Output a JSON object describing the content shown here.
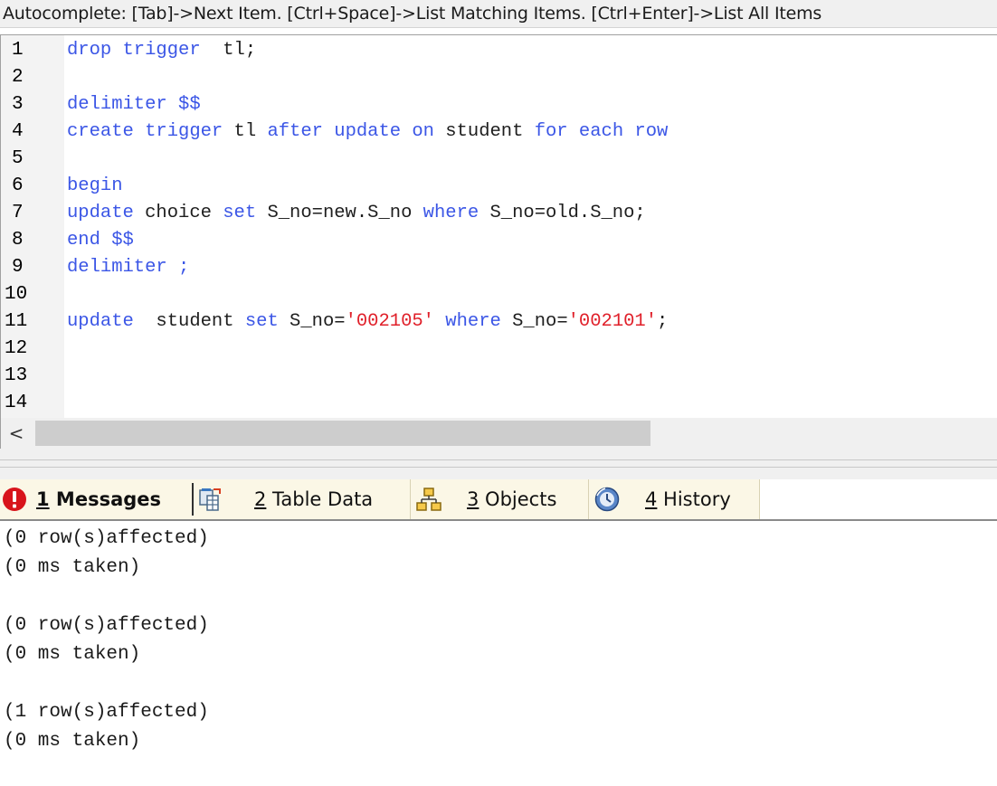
{
  "hint_bar": {
    "text": "Autocomplete: [Tab]->Next Item. [Ctrl+Space]->List Matching Items. [Ctrl+Enter]->List All Items"
  },
  "editor": {
    "lines": [
      {
        "num": "1",
        "segments": [
          {
            "t": "drop trigger",
            "kw": true
          },
          {
            "t": "  tl;",
            "kw": false
          }
        ]
      },
      {
        "num": "2",
        "segments": []
      },
      {
        "num": "3",
        "segments": [
          {
            "t": "delimiter $$",
            "kw": true
          }
        ]
      },
      {
        "num": "4",
        "segments": [
          {
            "t": "create trigger",
            "kw": true
          },
          {
            "t": " tl ",
            "kw": false
          },
          {
            "t": "after update on",
            "kw": true
          },
          {
            "t": " student ",
            "kw": false
          },
          {
            "t": "for each row",
            "kw": true
          }
        ]
      },
      {
        "num": "5",
        "segments": []
      },
      {
        "num": "6",
        "segments": [
          {
            "t": "begin",
            "kw": true
          }
        ]
      },
      {
        "num": "7",
        "segments": [
          {
            "t": "update",
            "kw": true
          },
          {
            "t": " choice ",
            "kw": false
          },
          {
            "t": "set",
            "kw": true
          },
          {
            "t": " S_no=new.S_no ",
            "kw": false
          },
          {
            "t": "where",
            "kw": true
          },
          {
            "t": " S_no=old.S_no;",
            "kw": false
          }
        ]
      },
      {
        "num": "8",
        "segments": [
          {
            "t": "end $$",
            "kw": true
          }
        ]
      },
      {
        "num": "9",
        "segments": [
          {
            "t": "delimiter ;",
            "kw": true
          }
        ]
      },
      {
        "num": "10",
        "segments": []
      },
      {
        "num": "11",
        "segments": [
          {
            "t": "update",
            "kw": true
          },
          {
            "t": "  student ",
            "kw": false
          },
          {
            "t": "set",
            "kw": true
          },
          {
            "t": " S_no=",
            "kw": false
          },
          {
            "t": "'002105'",
            "str": true
          },
          {
            "t": " ",
            "kw": false
          },
          {
            "t": "where",
            "kw": true
          },
          {
            "t": " S_no=",
            "kw": false
          },
          {
            "t": "'002101'",
            "str": true
          },
          {
            "t": ";",
            "kw": false
          }
        ]
      },
      {
        "num": "12",
        "segments": []
      },
      {
        "num": "13",
        "segments": []
      },
      {
        "num": "14",
        "segments": []
      }
    ]
  },
  "scrollbar": {
    "left_arrow": "<"
  },
  "tabs": [
    {
      "num": "1",
      "label": " Messages",
      "icon": "error-icon",
      "active": true
    },
    {
      "num": "2",
      "label": " Table Data",
      "icon": "table-data-icon",
      "active": false
    },
    {
      "num": "3",
      "label": " Objects",
      "icon": "objects-icon",
      "active": false
    },
    {
      "num": "4",
      "label": " History",
      "icon": "history-icon",
      "active": false
    }
  ],
  "messages": [
    "(0 row(s)affected)",
    "(0 ms taken)",
    "",
    "(0 row(s)affected)",
    "(0 ms taken)",
    "",
    "(1 row(s)affected)",
    "(0 ms taken)"
  ],
  "colors": {
    "keyword": "#3b56e6",
    "string": "#e0202a",
    "tab_bar": "#fbf7e6",
    "error_icon": "#d8141b"
  }
}
